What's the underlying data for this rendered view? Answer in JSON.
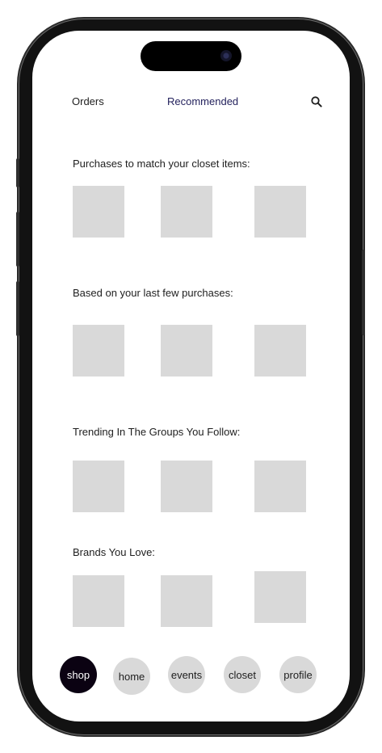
{
  "topnav": {
    "orders_label": "Orders",
    "recommended_label": "Recommended",
    "search_icon": "search-icon"
  },
  "sections": [
    {
      "title": "Purchases to match your closet items:"
    },
    {
      "title": "Based on your last few purchases:"
    },
    {
      "title": "Trending In The Groups You Follow:"
    },
    {
      "title": "Brands You Love:"
    }
  ],
  "bottom_nav": {
    "items": [
      {
        "label": "shop",
        "active": true
      },
      {
        "label": "home"
      },
      {
        "label": "events"
      },
      {
        "label": "closet"
      },
      {
        "label": "profile"
      }
    ]
  },
  "colors": {
    "accent_text": "#24225d",
    "active_nav": "#0b0212",
    "placeholder": "#d9d9d9"
  }
}
